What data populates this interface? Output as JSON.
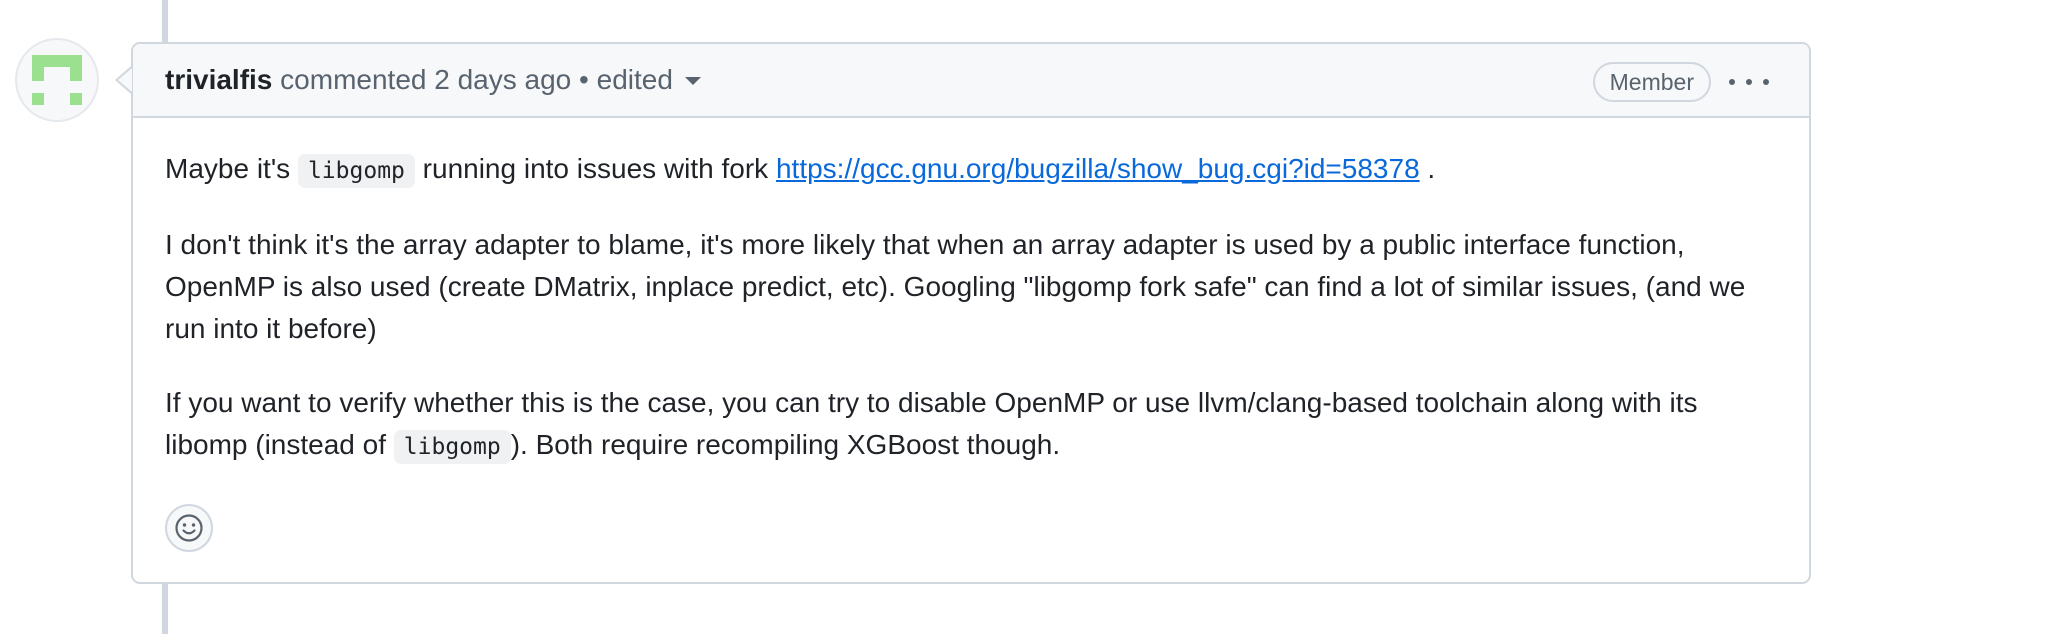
{
  "comment": {
    "author": "trivialfis",
    "action": "commented",
    "time": "2 days ago",
    "separator": "•",
    "edited_label": "edited",
    "role_badge": "Member",
    "paragraphs": [
      {
        "pre": "Maybe it's",
        "code": "libgomp",
        "mid": "running into issues with fork",
        "link": "https://gcc.gnu.org/bugzilla/show_bug.cgi?id=58378",
        "post": "."
      },
      {
        "text": "I don't think it's the array adapter to blame, it's more likely that when an array adapter is used by a public interface function, OpenMP is also used (create DMatrix, inplace predict, etc). Googling \"libgomp fork safe\" can find a lot of similar issues, (and we run into it before)"
      },
      {
        "pre": "If you want to verify whether this is the case, you can try to disable OpenMP or use llvm/clang-based toolchain along with its libomp (instead of",
        "code": "libgomp",
        "post": "). Both require recompiling XGBoost though."
      }
    ]
  },
  "icons": {
    "avatar": "identicon-avatar",
    "more": "kebab-horizontal-icon",
    "reaction": "smiley-icon",
    "edited_menu": "triangle-down-icon"
  },
  "colors": {
    "link": "#0969da",
    "border": "#d0d7de",
    "header_bg": "#f6f8fa",
    "avatar_green": "#9be08f"
  }
}
